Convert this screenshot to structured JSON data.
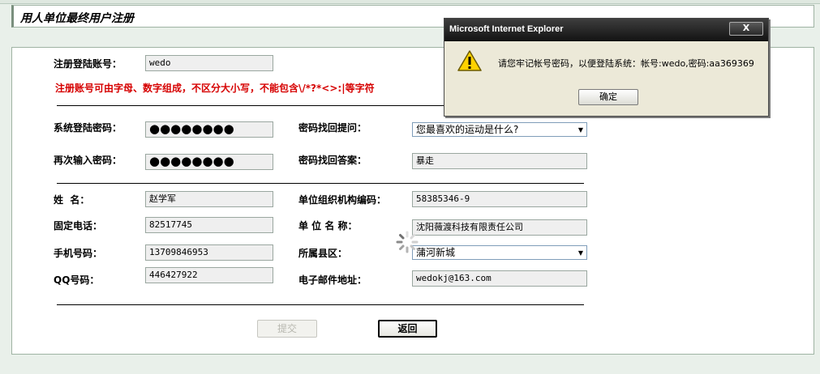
{
  "page": {
    "title": "用人单位最终用户注册"
  },
  "form": {
    "account_label": "注册登陆账号：",
    "account_value": "wedo",
    "account_hint": "注册账号可由字母、数字组成，不区分大小写，不能包含\\/*?*<>:|等字符",
    "password_label": "系统登陆密码：",
    "password_value": "●●●●●●●●",
    "password_confirm_label": "再次输入密码：",
    "password_confirm_value": "●●●●●●●●",
    "question_label": "密码找回提问：",
    "question_value": "您最喜欢的运动是什么?",
    "answer_label": "密码找回答案：",
    "answer_value": "暴走",
    "name_label": "姓  名：",
    "name_value": "赵学军",
    "org_code_label": "单位组织机构编码：",
    "org_code_value": "58385346-9",
    "phone_label": "固定电话：",
    "phone_value": "82517745",
    "company_label": "单 位 名 称：",
    "company_value": "沈阳薇渡科技有限责任公司",
    "mobile_label": "手机号码：",
    "mobile_value": "13709846953",
    "district_label": "所属县区：",
    "district_value": "蒲河新城",
    "qq_label": "QQ号码：",
    "qq_value": "446427922",
    "email_label": "电子邮件地址：",
    "email_value": "wedokj@163.com",
    "submit_label": "提交",
    "back_label": "返回"
  },
  "dialog": {
    "title": "Microsoft Internet Explorer",
    "close_label": "X",
    "message": "请您牢记帐号密码，以便登陆系统：帐号:wedo,密码:aa369369",
    "ok_label": "确定"
  },
  "colors": {
    "hint": "#d60000",
    "background": "#e9f0ea",
    "dialog_title": "#121212"
  }
}
